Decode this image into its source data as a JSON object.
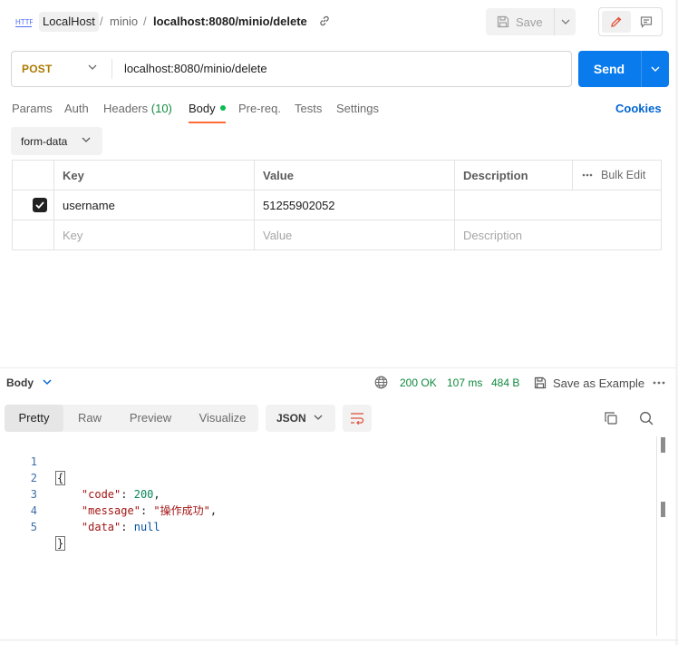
{
  "breadcrumb": {
    "collection": "LocalHost",
    "folder": "minio",
    "separator": "/",
    "request_title": "localhost:8080/minio/delete"
  },
  "toolbar": {
    "save_label": "Save"
  },
  "request": {
    "method": "POST",
    "url": "localhost:8080/minio/delete",
    "send_label": "Send"
  },
  "tabs": {
    "params": "Params",
    "auth": "Auth",
    "headers": "Headers",
    "headers_count": "(10)",
    "body": "Body",
    "prereq": "Pre-req.",
    "tests": "Tests",
    "settings": "Settings",
    "cookies": "Cookies"
  },
  "body_type": "form-data",
  "table": {
    "headers": {
      "key": "Key",
      "value": "Value",
      "description": "Description",
      "bulk_edit": "Bulk Edit"
    },
    "rows": [
      {
        "key": "username",
        "value": "51255902052",
        "description": "",
        "checked": true
      }
    ],
    "placeholder": {
      "key": "Key",
      "value": "Value",
      "description": "Description"
    }
  },
  "response": {
    "label": "Body",
    "status": "200 OK",
    "time": "107 ms",
    "size": "484 B",
    "save_example": "Save as Example",
    "view_tabs": {
      "pretty": "Pretty",
      "raw": "Raw",
      "preview": "Preview",
      "visualize": "Visualize"
    },
    "format": "JSON",
    "lines": {
      "n1": "1",
      "n2": "2",
      "n3": "3",
      "n4": "4",
      "n5": "5",
      "open": "{",
      "close": "}",
      "code_key": "\"code\"",
      "code_val": "200",
      "message_key": "\"message\"",
      "message_val": "\"操作成功\"",
      "data_key": "\"data\"",
      "data_val": "null"
    }
  },
  "colors": {
    "method_post": "#ad7a03",
    "send": "#097bed",
    "status_ok": "#0f8a3d",
    "active_tab": "#ff6c37",
    "link": "#0265d2"
  }
}
